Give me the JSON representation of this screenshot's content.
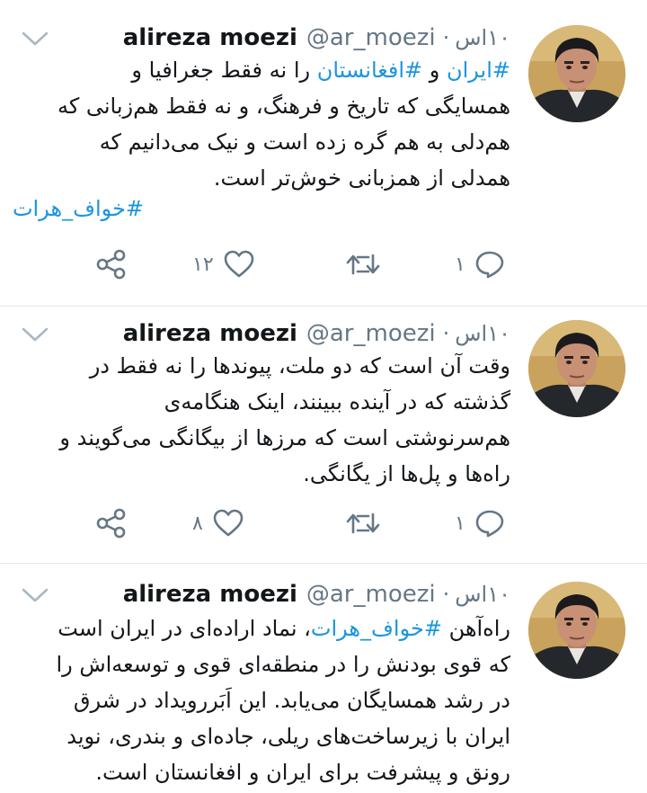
{
  "tweets": [
    {
      "author_name": "alireza moezi",
      "handle": "@ar_moezi",
      "separator": "·",
      "time": "۱۰اس",
      "lines": [
        [
          {
            "t": "#ایران",
            "tag": true
          },
          {
            "t": " و ",
            "tag": false
          },
          {
            "t": "#افغانستان",
            "tag": true
          },
          {
            "t": " را نه فقط جغرافیا و",
            "tag": false
          }
        ],
        [
          {
            "t": "همسایگی که تاریخ و فرهنگ، و نه فقط هم‌زبانی که",
            "tag": false
          }
        ],
        [
          {
            "t": "هم‌دلی به هم گره زده است و نیک می‌دانیم که",
            "tag": false
          }
        ],
        [
          {
            "t": "همدلی از همزبانی خوش‌تر است.",
            "tag": false
          }
        ]
      ],
      "hashtag_line": "#خواف_هرات",
      "reply_count": "۱",
      "like_count": "۱۲"
    },
    {
      "author_name": "alireza moezi",
      "handle": "@ar_moezi",
      "separator": "·",
      "time": "۱۰اس",
      "lines": [
        [
          {
            "t": "وقت آن است که دو ملت، پیوندها را نه فقط در",
            "tag": false
          }
        ],
        [
          {
            "t": "گذشته که در آینده ببینند، اینک هنگامه‌ی",
            "tag": false
          }
        ],
        [
          {
            "t": "هم‌سرنوشتی است که مرزها از بیگانگی می‌گویند و",
            "tag": false
          }
        ],
        [
          {
            "t": "راه‌ها و پل‌ها از یگانگی.",
            "tag": false
          }
        ]
      ],
      "hashtag_line": "",
      "reply_count": "۱",
      "like_count": "۸"
    },
    {
      "author_name": "alireza moezi",
      "handle": "@ar_moezi",
      "separator": "·",
      "time": "۱۰اس",
      "lines": [
        [
          {
            "t": "راه‌آهن ",
            "tag": false
          },
          {
            "t": "#خواف_هرات",
            "tag": true
          },
          {
            "t": "، نماد اراده‌ای در ایران است",
            "tag": false
          }
        ],
        [
          {
            "t": "که قوی بودنش را در منطقه‌ای قوی و توسعه‌اش را",
            "tag": false
          }
        ],
        [
          {
            "t": "در رشد همسایگان می‌یابد. این اَبَررویداد در شرق",
            "tag": false
          }
        ],
        [
          {
            "t": "ایران با زیرساخت‌های ریلی، جاده‌ای و بندری، نوید",
            "tag": false
          }
        ],
        [
          {
            "t": "رونق و پیشرفت برای ایران و افغانستان است.",
            "tag": false
          }
        ]
      ],
      "hashtag_line": "",
      "reply_count": "",
      "like_count": ""
    }
  ],
  "colors": {
    "link": "#1b95e0",
    "secondary_text": "#657786",
    "divider": "#e1e8ed",
    "like_heart": "#e0245e"
  },
  "icons": {
    "reply": "reply-icon",
    "retweet": "retweet-icon",
    "like": "heart-icon",
    "share": "share-icon",
    "caret": "chevron-down-icon"
  }
}
